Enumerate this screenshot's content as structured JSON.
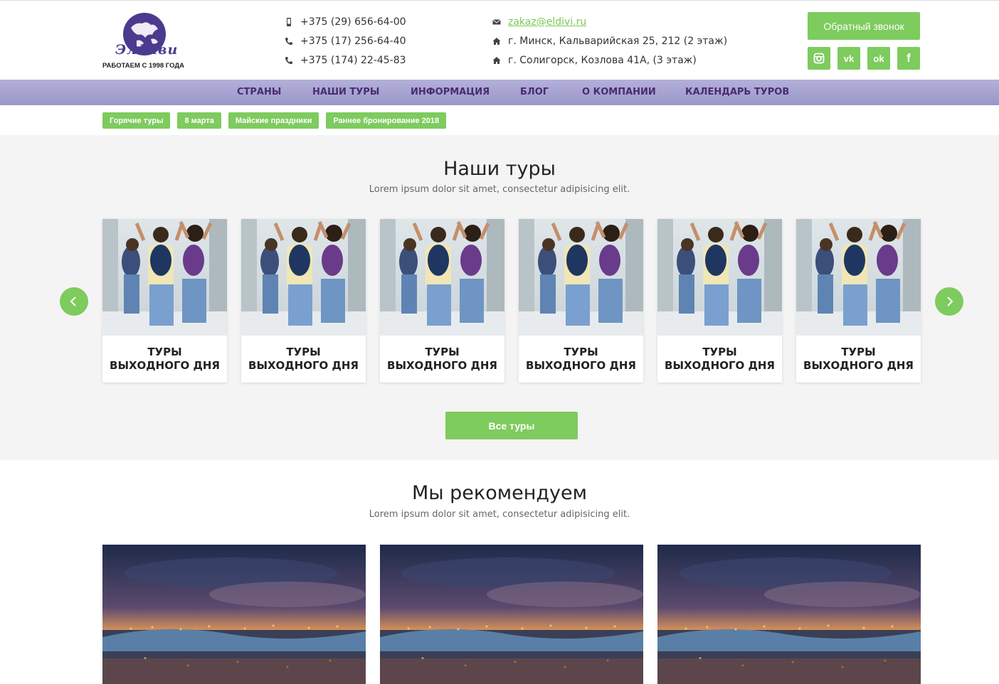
{
  "logo": {
    "script_text": "Элдиви",
    "tagline": "РАБОТАЕМ С 1998 ГОДА"
  },
  "contacts": {
    "phones": [
      {
        "icon": "mobile-icon",
        "text": "+375 (29) 656-64-00"
      },
      {
        "icon": "phone-icon",
        "text": "+375 (17) 256-64-40"
      },
      {
        "icon": "phone-icon",
        "text": "+375 (174) 22-45-83"
      }
    ],
    "email": {
      "icon": "envelope-icon",
      "text": "zakaz@eldivi.ru"
    },
    "addresses": [
      {
        "icon": "home-icon",
        "text": "г. Минск, Кальварийская 25, 212 (2 этаж)"
      },
      {
        "icon": "home-icon",
        "text": "г. Солигорск, Козлова 41А, (3 этаж)"
      }
    ]
  },
  "header": {
    "callback_label": "Обратный звонок",
    "socials": [
      {
        "name": "instagram-icon",
        "glyph": "◘"
      },
      {
        "name": "vk-icon",
        "glyph": "vk"
      },
      {
        "name": "odnoklassniki-icon",
        "glyph": "ok"
      },
      {
        "name": "facebook-icon",
        "glyph": "f"
      }
    ]
  },
  "nav": {
    "items": [
      "СТРАНЫ",
      "НАШИ ТУРЫ",
      "ИНФОРМАЦИЯ",
      "БЛОГ",
      "О КОМПАНИИ",
      "КАЛЕНДАРЬ ТУРОВ"
    ]
  },
  "tags": [
    "Горячие туры",
    "8 марта",
    "Майские праздники",
    "Раннее бронирование 2018"
  ],
  "tours": {
    "title": "Наши туры",
    "subtitle": "Lorem ipsum dolor sit amet, consectetur adipisicing elit.",
    "cards": [
      {
        "line1": "ТУРЫ",
        "line2": "ВЫХОДНОГО ДНЯ"
      },
      {
        "line1": "ТУРЫ",
        "line2": "ВЫХОДНОГО ДНЯ"
      },
      {
        "line1": "ТУРЫ",
        "line2": "ВЫХОДНОГО ДНЯ"
      },
      {
        "line1": "ТУРЫ",
        "line2": "ВЫХОДНОГО ДНЯ"
      },
      {
        "line1": "ТУРЫ",
        "line2": "ВЫХОДНОГО ДНЯ"
      },
      {
        "line1": "ТУРЫ",
        "line2": "ВЫХОДНОГО ДНЯ"
      }
    ],
    "all_label": "Все туры"
  },
  "recommend": {
    "title": "Мы рекомендуем",
    "subtitle": "Lorem ipsum dolor sit amet, consectetur adipisicing elit."
  },
  "colors": {
    "accent": "#7ecb5e",
    "nav_bg": "#a8a5d3",
    "nav_text": "#4a2a72",
    "logo": "#4b3a8f"
  }
}
